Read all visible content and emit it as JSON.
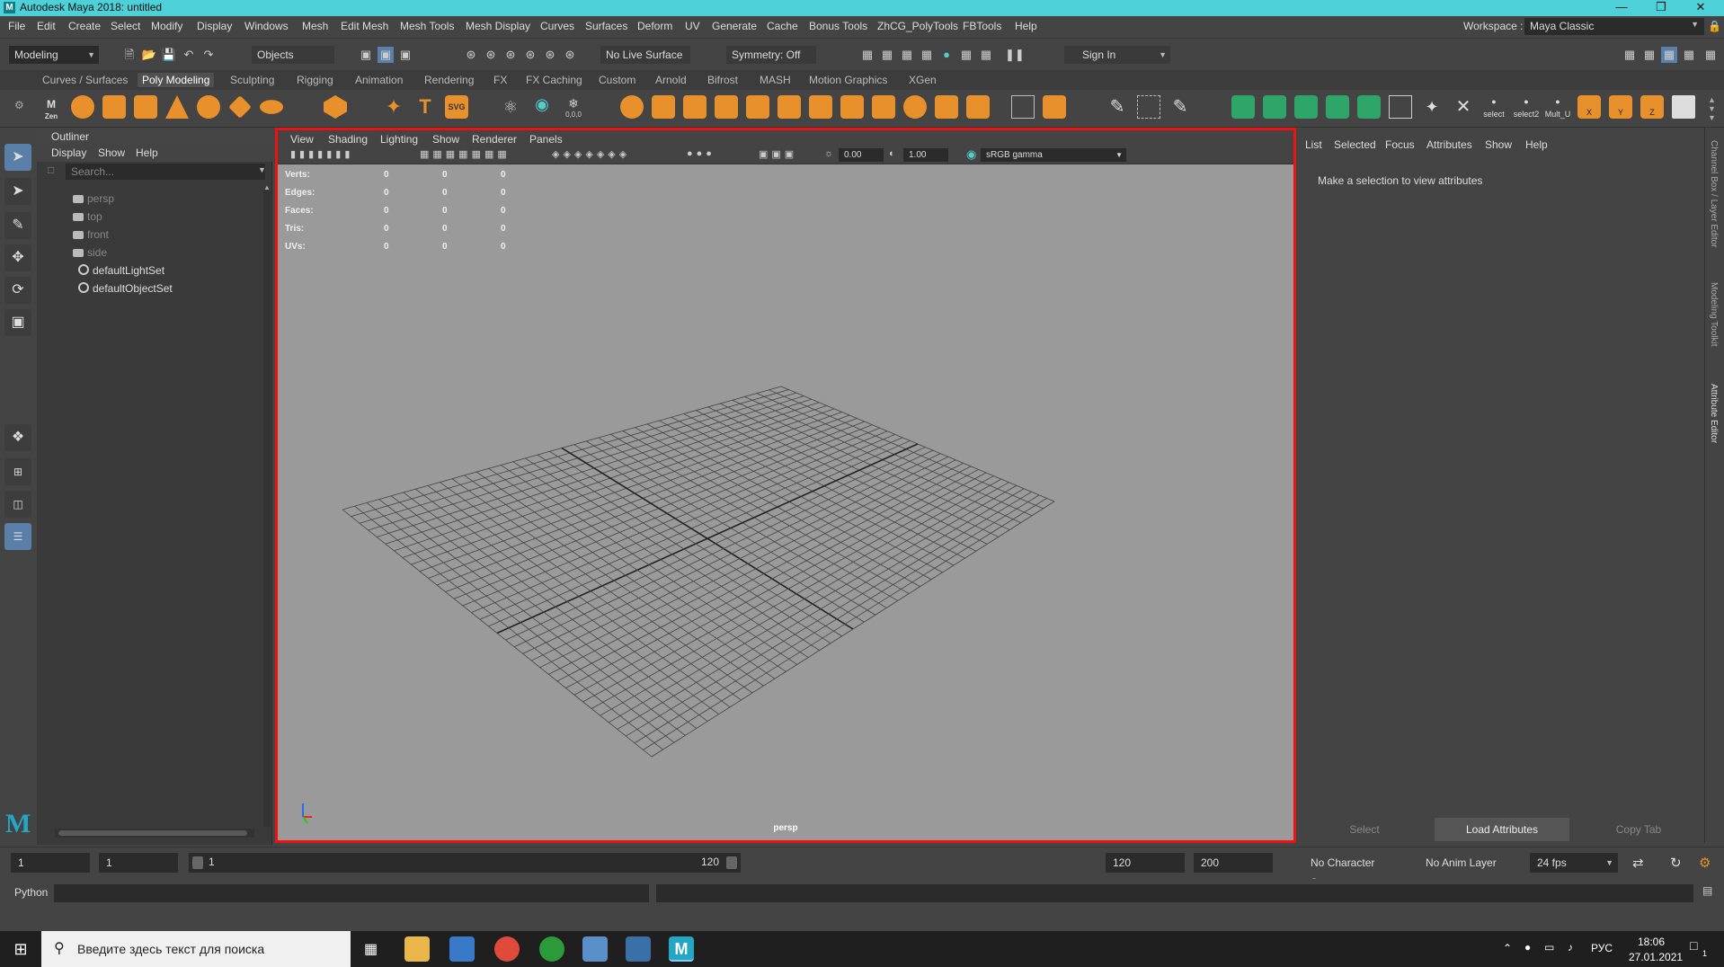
{
  "window": {
    "title": "Autodesk Maya 2018: untitled",
    "logo": "M"
  },
  "menus": [
    "File",
    "Edit",
    "Create",
    "Select",
    "Modify",
    "Display",
    "Windows",
    "Mesh",
    "Edit Mesh",
    "Mesh Tools",
    "Mesh Display",
    "Curves",
    "Surfaces",
    "Deform",
    "UV",
    "Generate",
    "Cache",
    "Bonus Tools",
    "ZhCG_PolyTools",
    "FBTools",
    "Help"
  ],
  "workspace": {
    "label": "Workspace :",
    "value": "Maya Classic"
  },
  "statusline": {
    "menuset": "Modeling",
    "objects": "Objects",
    "live_surface": "No Live Surface",
    "symmetry": "Symmetry: Off",
    "sign_in": "Sign In"
  },
  "shelf_tabs": [
    "Curves / Surfaces",
    "Poly Modeling",
    "Sculpting",
    "Rigging",
    "Animation",
    "Rendering",
    "FX",
    "FX Caching",
    "Custom",
    "Arnold",
    "Bifrost",
    "MASH",
    "Motion Graphics",
    "XGen"
  ],
  "shelf_active": "Poly Modeling",
  "shelf_labels": {
    "zen": "Zen",
    "svg": "SVG",
    "origin": "0,0,0",
    "select": "select",
    "select2": "select2",
    "mult": "Mult_U",
    "x": "X",
    "y": "Y",
    "z": "Z"
  },
  "outliner": {
    "title": "Outliner",
    "menu": [
      "Display",
      "Show",
      "Help"
    ],
    "search_placeholder": "Search...",
    "items": [
      {
        "label": "persp",
        "type": "camera",
        "dim": true
      },
      {
        "label": "top",
        "type": "camera",
        "dim": true
      },
      {
        "label": "front",
        "type": "camera",
        "dim": true
      },
      {
        "label": "side",
        "type": "camera",
        "dim": true
      },
      {
        "label": "defaultLightSet",
        "type": "set",
        "dim": false
      },
      {
        "label": "defaultObjectSet",
        "type": "set",
        "dim": false
      }
    ]
  },
  "viewport": {
    "menu": [
      "View",
      "Shading",
      "Lighting",
      "Show",
      "Renderer",
      "Panels"
    ],
    "exposure": "0.00",
    "gamma": "1.00",
    "colorspace": "sRGB gamma",
    "camera": "persp",
    "hud": [
      {
        "label": "Verts:",
        "a": "0",
        "b": "0",
        "c": "0"
      },
      {
        "label": "Edges:",
        "a": "0",
        "b": "0",
        "c": "0"
      },
      {
        "label": "Faces:",
        "a": "0",
        "b": "0",
        "c": "0"
      },
      {
        "label": "Tris:",
        "a": "0",
        "b": "0",
        "c": "0"
      },
      {
        "label": "UVs:",
        "a": "0",
        "b": "0",
        "c": "0"
      }
    ]
  },
  "attribute_editor": {
    "menu": [
      "List",
      "Selected",
      "Focus",
      "Attributes",
      "Show",
      "Help"
    ],
    "message": "Make a selection to view attributes",
    "buttons": [
      "Select",
      "Load Attributes",
      "Copy Tab"
    ]
  },
  "side_tabs": [
    "Channel Box / Layer Editor",
    "Modeling Toolkit",
    "Attribute Editor"
  ],
  "timeline": {
    "start": "1",
    "current": "1",
    "range_start": "1",
    "range_end": "120",
    "end": "120",
    "max": "200",
    "char_set": "No Character Set",
    "anim_layer": "No Anim Layer",
    "fps": "24 fps"
  },
  "cmdline": {
    "lang": "Python"
  },
  "taskbar": {
    "search_placeholder": "Введите здесь текст для поиска",
    "lang": "РУС",
    "time": "18:06",
    "date": "27.01.2021",
    "notif": "1"
  }
}
